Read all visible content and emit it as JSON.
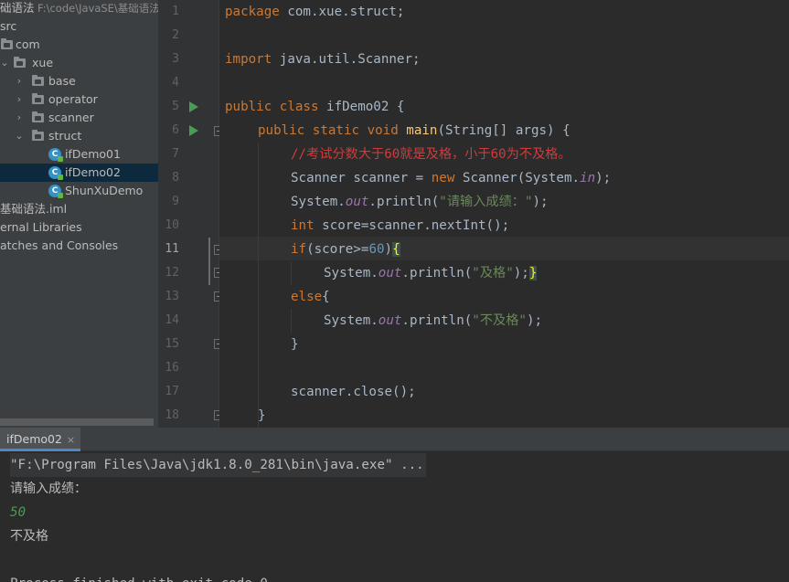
{
  "project_tree": {
    "root_label": "础语法",
    "root_path": "F:\\code\\JavaSE\\基础语法",
    "items": [
      {
        "label": "src"
      },
      {
        "label": "com"
      },
      {
        "label": "xue"
      },
      {
        "label": "base"
      },
      {
        "label": "operator"
      },
      {
        "label": "scanner"
      },
      {
        "label": "struct"
      },
      {
        "label": "ifDemo01"
      },
      {
        "label": "ifDemo02",
        "selected": true
      },
      {
        "label": "ShunXuDemo"
      },
      {
        "label": "基础语法.iml"
      },
      {
        "label": "ernal Libraries"
      },
      {
        "label": "atches and Consoles"
      }
    ],
    "class_icon_letter": "C"
  },
  "editor": {
    "current_line": 11,
    "lines": [
      {
        "n": "1"
      },
      {
        "n": "2"
      },
      {
        "n": "3"
      },
      {
        "n": "4"
      },
      {
        "n": "5"
      },
      {
        "n": "6"
      },
      {
        "n": "7"
      },
      {
        "n": "8"
      },
      {
        "n": "9"
      },
      {
        "n": "10"
      },
      {
        "n": "11"
      },
      {
        "n": "12"
      },
      {
        "n": "13"
      },
      {
        "n": "14"
      },
      {
        "n": "15"
      },
      {
        "n": "16"
      },
      {
        "n": "17"
      },
      {
        "n": "18"
      }
    ],
    "tokens": {
      "l1_kw": "package",
      "l1_rest": " com.xue.struct;",
      "l3_kw": "import",
      "l3_rest": " java.util.Scanner;",
      "l5_kw": "public class",
      "l5_rest": " ifDemo02 {",
      "l6_kw": "public static void",
      "l6_fn": "main",
      "l6_rest": "(String[] args) {",
      "l7_cmt": "//考试分数大于60就是及格，小于60为不及格。",
      "l8_a": "Scanner scanner = ",
      "l8_kw": "new",
      "l8_b": " Scanner(System.",
      "l8_fld": "in",
      "l8_c": ");",
      "l9_a": "System.",
      "l9_fld": "out",
      "l9_b": ".println(",
      "l9_str": "\"请输入成绩：\"",
      "l9_c": ");",
      "l10_kw": "int",
      "l10_rest": " score=scanner.nextInt();",
      "l11_kw": "if",
      "l11_a": "(score>=",
      "l11_num": "60",
      "l11_b": ")",
      "l11_brace": "{",
      "l12_a": "System.",
      "l12_fld": "out",
      "l12_b": ".println(",
      "l12_str": "\"及格\"",
      "l12_c": ");",
      "l12_brace": "}",
      "l13_kw": "else",
      "l13_rest": "{",
      "l14_a": "System.",
      "l14_fld": "out",
      "l14_b": ".println(",
      "l14_str": "\"不及格\"",
      "l14_c": ");",
      "l15_rest": "}",
      "l17_rest": "scanner.close();",
      "l18_rest": "}"
    }
  },
  "run_panel": {
    "tab_label": "ifDemo02",
    "close_glyph": "×",
    "output": [
      "\"F:\\Program Files\\Java\\jdk1.8.0_281\\bin\\java.exe\" ...",
      "请输入成绩：",
      "50",
      "不及格",
      "",
      "Process finished with exit code 0"
    ]
  },
  "colors": {
    "keyword": "#cc7832",
    "string": "#6a8759",
    "number": "#6897bb",
    "field": "#9876aa",
    "method": "#ffc66d",
    "comment": "#d33a3a",
    "run_icon": "#499c54",
    "selection": "#0d293e"
  }
}
